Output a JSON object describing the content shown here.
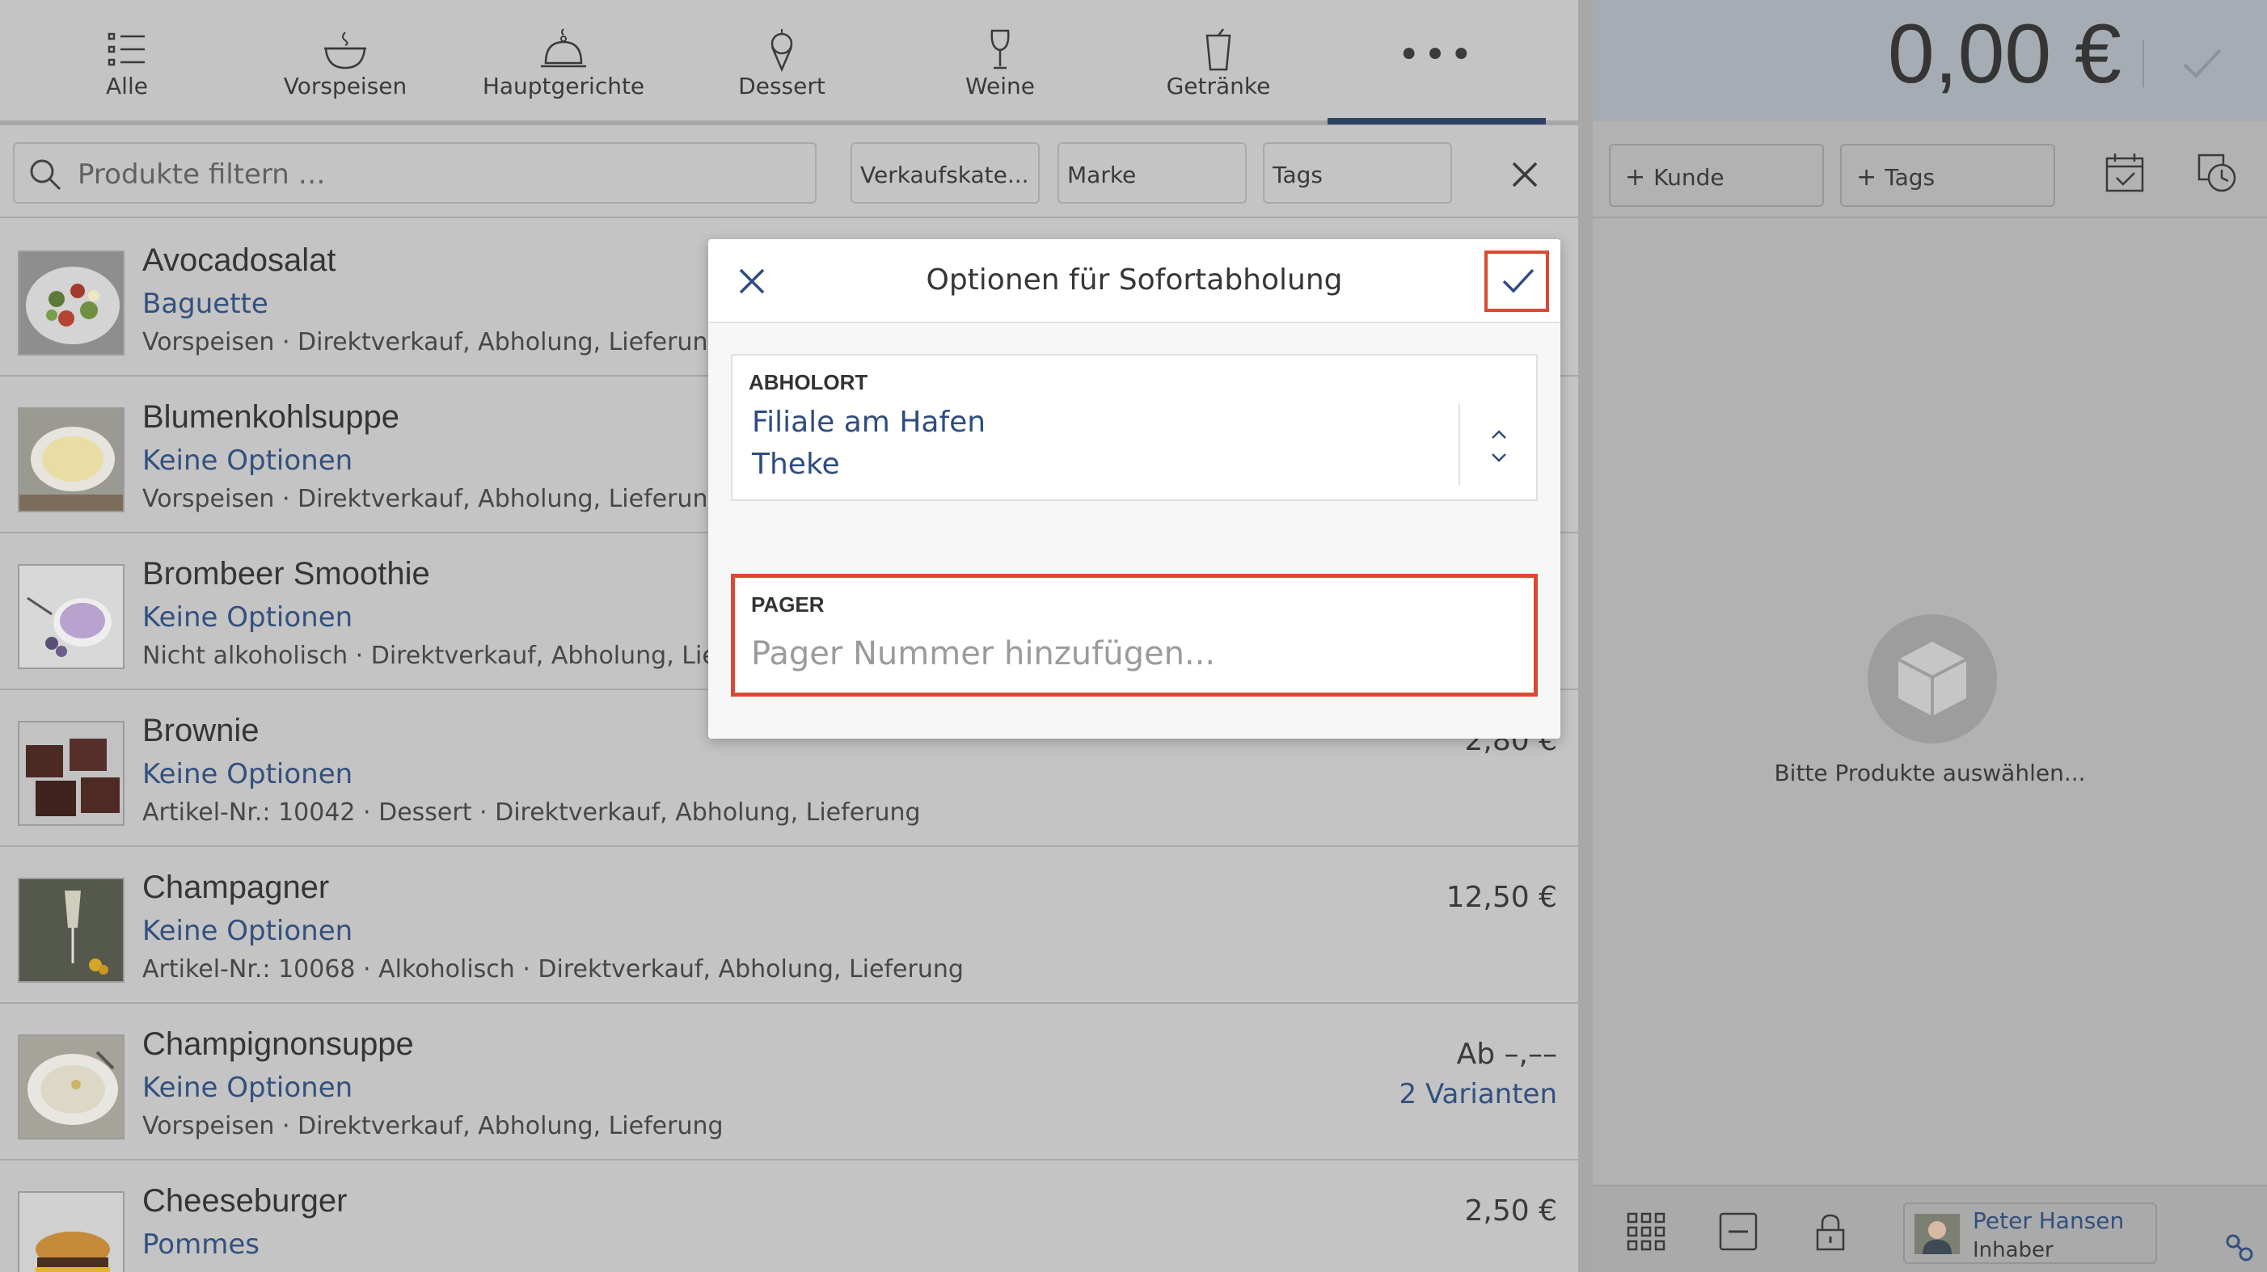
{
  "categories": [
    {
      "label": "Alle",
      "icon": "list-icon"
    },
    {
      "label": "Vorspeisen",
      "icon": "soup-bowl-icon"
    },
    {
      "label": "Hauptgerichte",
      "icon": "cloche-icon"
    },
    {
      "label": "Dessert",
      "icon": "ice-cream-icon"
    },
    {
      "label": "Weine",
      "icon": "wine-glass-icon"
    },
    {
      "label": "Getränke",
      "icon": "cup-icon"
    }
  ],
  "more_label": "•••",
  "filter": {
    "search_placeholder": "Produkte filtern …",
    "sales_category": "Verkaufskate...",
    "brand": "Marke",
    "tags": "Tags"
  },
  "products": [
    {
      "name": "Avocadosalat",
      "option": "Baguette",
      "meta": "Vorspeisen · Direktverkauf, Abholung, Lieferung",
      "price": "",
      "price2": ""
    },
    {
      "name": "Blumenkohlsuppe",
      "option": "Keine Optionen",
      "meta": "Vorspeisen · Direktverkauf, Abholung, Lieferung",
      "price": "",
      "price2": ""
    },
    {
      "name": "Brombeer Smoothie",
      "option": "Keine Optionen",
      "meta": "Nicht alkoholisch · Direktverkauf, Abholung, Lieferung",
      "price": "",
      "price2": ""
    },
    {
      "name": "Brownie",
      "option": "Keine Optionen",
      "meta": "Artikel-Nr.: 10042 · Dessert · Direktverkauf, Abholung, Lieferung",
      "price": "2,80 €",
      "price2": ""
    },
    {
      "name": "Champagner",
      "option": "Keine Optionen",
      "meta": "Artikel-Nr.: 10068 · Alkoholisch · Direktverkauf, Abholung, Lieferung",
      "price": "12,50 €",
      "price2": ""
    },
    {
      "name": "Champignonsuppe",
      "option": "Keine Optionen",
      "meta": "Vorspeisen · Direktverkauf, Abholung, Lieferung",
      "price": "Ab –,––",
      "price2": "2 Varianten"
    },
    {
      "name": "Cheeseburger",
      "option": "Pommes",
      "meta": "",
      "price": "2,50 €",
      "price2": ""
    }
  ],
  "cart": {
    "total": "0,00 €",
    "customer_button": "Kunde",
    "tags_button": "Tags",
    "empty_text": "Bitte Produkte auswählen...",
    "user_name": "Peter Hansen",
    "user_role": "Inhaber"
  },
  "dialog": {
    "title": "Optionen für Sofortabholung",
    "pickup_label": "ABHOLORT",
    "pickup_location": "Filiale am Hafen",
    "pickup_point": "Theke",
    "pager_label": "PAGER",
    "pager_placeholder": "Pager Nummer hinzufügen...",
    "pager_value": ""
  },
  "colors": {
    "accent": "#2f4c80",
    "highlight": "#d94a32"
  }
}
